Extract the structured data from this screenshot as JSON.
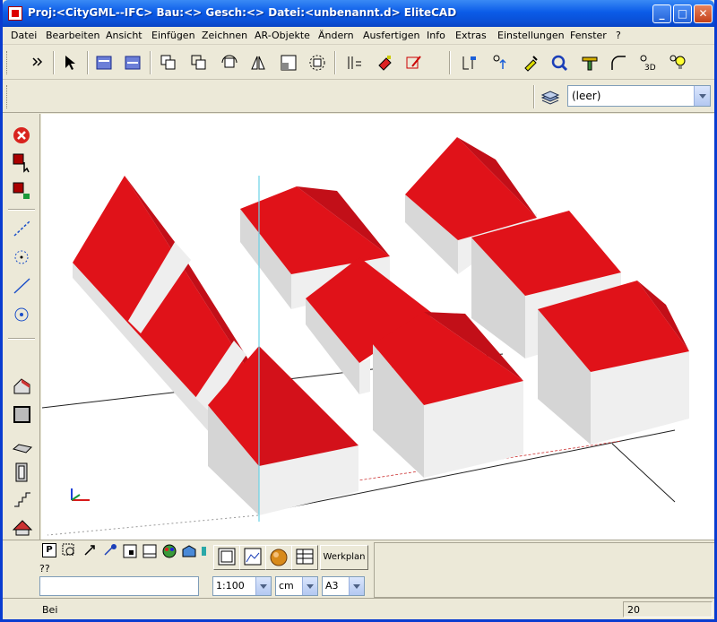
{
  "window": {
    "title": "Proj:<CityGML--IFC> Bau:<> Gesch:<> Datei:<unbenannt.d> EliteCAD",
    "min_symbol": "_",
    "max_symbol": "□",
    "close_symbol": "✕"
  },
  "menu": {
    "items": [
      "Datei",
      "Bearbeiten",
      "Ansicht",
      "Einfügen",
      "Zeichnen",
      "AR-Objekte",
      "Ändern",
      "Ausfertigen",
      "Info",
      "Extras",
      "Einstellungen",
      "Fenster",
      "?"
    ]
  },
  "layer_select": {
    "value": "(leer)"
  },
  "bottom_panel": {
    "command_label": "??",
    "command_value": "",
    "workplane_label": "Werkplan",
    "scale": "1:100",
    "unit": "cm",
    "paper": "A3",
    "toolbar_text": "P"
  },
  "status": {
    "message": "Bei",
    "value": "20"
  },
  "colors": {
    "roof": "#e01219",
    "roof_dark": "#c0101a",
    "wall_front": "#e9e9e9",
    "wall_side": "#d0d0d0",
    "titlebar": "#0b5ce8",
    "axis_line": "#6ad2e6"
  }
}
